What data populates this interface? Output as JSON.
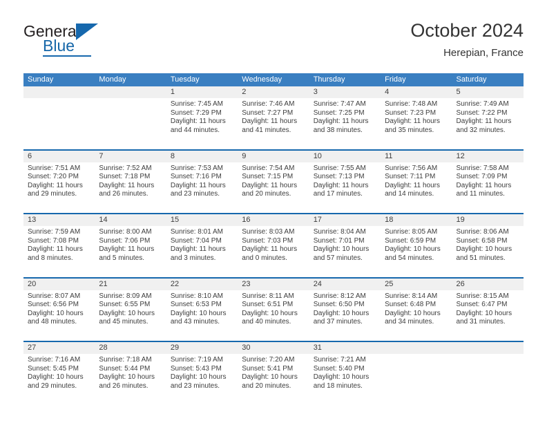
{
  "brand": {
    "name_part1": "General",
    "name_part2": "Blue",
    "accent_color": "#1668ad"
  },
  "header": {
    "title": "October 2024",
    "subtitle": "Herepian, France"
  },
  "calendar": {
    "header_bg": "#3a7fc1",
    "row_rule_color": "#1668ad",
    "day_band_bg": "#f0f0f0",
    "weekdays": [
      "Sunday",
      "Monday",
      "Tuesday",
      "Wednesday",
      "Thursday",
      "Friday",
      "Saturday"
    ],
    "weeks": [
      [
        {
          "day": "",
          "empty": true,
          "sunrise": "",
          "sunset": "",
          "daylight_line1": "",
          "daylight_line2": ""
        },
        {
          "day": "",
          "empty": true,
          "sunrise": "",
          "sunset": "",
          "daylight_line1": "",
          "daylight_line2": ""
        },
        {
          "day": "1",
          "empty": false,
          "sunrise": "Sunrise: 7:45 AM",
          "sunset": "Sunset: 7:29 PM",
          "daylight_line1": "Daylight: 11 hours",
          "daylight_line2": "and 44 minutes."
        },
        {
          "day": "2",
          "empty": false,
          "sunrise": "Sunrise: 7:46 AM",
          "sunset": "Sunset: 7:27 PM",
          "daylight_line1": "Daylight: 11 hours",
          "daylight_line2": "and 41 minutes."
        },
        {
          "day": "3",
          "empty": false,
          "sunrise": "Sunrise: 7:47 AM",
          "sunset": "Sunset: 7:25 PM",
          "daylight_line1": "Daylight: 11 hours",
          "daylight_line2": "and 38 minutes."
        },
        {
          "day": "4",
          "empty": false,
          "sunrise": "Sunrise: 7:48 AM",
          "sunset": "Sunset: 7:23 PM",
          "daylight_line1": "Daylight: 11 hours",
          "daylight_line2": "and 35 minutes."
        },
        {
          "day": "5",
          "empty": false,
          "sunrise": "Sunrise: 7:49 AM",
          "sunset": "Sunset: 7:22 PM",
          "daylight_line1": "Daylight: 11 hours",
          "daylight_line2": "and 32 minutes."
        }
      ],
      [
        {
          "day": "6",
          "empty": false,
          "sunrise": "Sunrise: 7:51 AM",
          "sunset": "Sunset: 7:20 PM",
          "daylight_line1": "Daylight: 11 hours",
          "daylight_line2": "and 29 minutes."
        },
        {
          "day": "7",
          "empty": false,
          "sunrise": "Sunrise: 7:52 AM",
          "sunset": "Sunset: 7:18 PM",
          "daylight_line1": "Daylight: 11 hours",
          "daylight_line2": "and 26 minutes."
        },
        {
          "day": "8",
          "empty": false,
          "sunrise": "Sunrise: 7:53 AM",
          "sunset": "Sunset: 7:16 PM",
          "daylight_line1": "Daylight: 11 hours",
          "daylight_line2": "and 23 minutes."
        },
        {
          "day": "9",
          "empty": false,
          "sunrise": "Sunrise: 7:54 AM",
          "sunset": "Sunset: 7:15 PM",
          "daylight_line1": "Daylight: 11 hours",
          "daylight_line2": "and 20 minutes."
        },
        {
          "day": "10",
          "empty": false,
          "sunrise": "Sunrise: 7:55 AM",
          "sunset": "Sunset: 7:13 PM",
          "daylight_line1": "Daylight: 11 hours",
          "daylight_line2": "and 17 minutes."
        },
        {
          "day": "11",
          "empty": false,
          "sunrise": "Sunrise: 7:56 AM",
          "sunset": "Sunset: 7:11 PM",
          "daylight_line1": "Daylight: 11 hours",
          "daylight_line2": "and 14 minutes."
        },
        {
          "day": "12",
          "empty": false,
          "sunrise": "Sunrise: 7:58 AM",
          "sunset": "Sunset: 7:09 PM",
          "daylight_line1": "Daylight: 11 hours",
          "daylight_line2": "and 11 minutes."
        }
      ],
      [
        {
          "day": "13",
          "empty": false,
          "sunrise": "Sunrise: 7:59 AM",
          "sunset": "Sunset: 7:08 PM",
          "daylight_line1": "Daylight: 11 hours",
          "daylight_line2": "and 8 minutes."
        },
        {
          "day": "14",
          "empty": false,
          "sunrise": "Sunrise: 8:00 AM",
          "sunset": "Sunset: 7:06 PM",
          "daylight_line1": "Daylight: 11 hours",
          "daylight_line2": "and 5 minutes."
        },
        {
          "day": "15",
          "empty": false,
          "sunrise": "Sunrise: 8:01 AM",
          "sunset": "Sunset: 7:04 PM",
          "daylight_line1": "Daylight: 11 hours",
          "daylight_line2": "and 3 minutes."
        },
        {
          "day": "16",
          "empty": false,
          "sunrise": "Sunrise: 8:03 AM",
          "sunset": "Sunset: 7:03 PM",
          "daylight_line1": "Daylight: 11 hours",
          "daylight_line2": "and 0 minutes."
        },
        {
          "day": "17",
          "empty": false,
          "sunrise": "Sunrise: 8:04 AM",
          "sunset": "Sunset: 7:01 PM",
          "daylight_line1": "Daylight: 10 hours",
          "daylight_line2": "and 57 minutes."
        },
        {
          "day": "18",
          "empty": false,
          "sunrise": "Sunrise: 8:05 AM",
          "sunset": "Sunset: 6:59 PM",
          "daylight_line1": "Daylight: 10 hours",
          "daylight_line2": "and 54 minutes."
        },
        {
          "day": "19",
          "empty": false,
          "sunrise": "Sunrise: 8:06 AM",
          "sunset": "Sunset: 6:58 PM",
          "daylight_line1": "Daylight: 10 hours",
          "daylight_line2": "and 51 minutes."
        }
      ],
      [
        {
          "day": "20",
          "empty": false,
          "sunrise": "Sunrise: 8:07 AM",
          "sunset": "Sunset: 6:56 PM",
          "daylight_line1": "Daylight: 10 hours",
          "daylight_line2": "and 48 minutes."
        },
        {
          "day": "21",
          "empty": false,
          "sunrise": "Sunrise: 8:09 AM",
          "sunset": "Sunset: 6:55 PM",
          "daylight_line1": "Daylight: 10 hours",
          "daylight_line2": "and 45 minutes."
        },
        {
          "day": "22",
          "empty": false,
          "sunrise": "Sunrise: 8:10 AM",
          "sunset": "Sunset: 6:53 PM",
          "daylight_line1": "Daylight: 10 hours",
          "daylight_line2": "and 43 minutes."
        },
        {
          "day": "23",
          "empty": false,
          "sunrise": "Sunrise: 8:11 AM",
          "sunset": "Sunset: 6:51 PM",
          "daylight_line1": "Daylight: 10 hours",
          "daylight_line2": "and 40 minutes."
        },
        {
          "day": "24",
          "empty": false,
          "sunrise": "Sunrise: 8:12 AM",
          "sunset": "Sunset: 6:50 PM",
          "daylight_line1": "Daylight: 10 hours",
          "daylight_line2": "and 37 minutes."
        },
        {
          "day": "25",
          "empty": false,
          "sunrise": "Sunrise: 8:14 AM",
          "sunset": "Sunset: 6:48 PM",
          "daylight_line1": "Daylight: 10 hours",
          "daylight_line2": "and 34 minutes."
        },
        {
          "day": "26",
          "empty": false,
          "sunrise": "Sunrise: 8:15 AM",
          "sunset": "Sunset: 6:47 PM",
          "daylight_line1": "Daylight: 10 hours",
          "daylight_line2": "and 31 minutes."
        }
      ],
      [
        {
          "day": "27",
          "empty": false,
          "sunrise": "Sunrise: 7:16 AM",
          "sunset": "Sunset: 5:45 PM",
          "daylight_line1": "Daylight: 10 hours",
          "daylight_line2": "and 29 minutes."
        },
        {
          "day": "28",
          "empty": false,
          "sunrise": "Sunrise: 7:18 AM",
          "sunset": "Sunset: 5:44 PM",
          "daylight_line1": "Daylight: 10 hours",
          "daylight_line2": "and 26 minutes."
        },
        {
          "day": "29",
          "empty": false,
          "sunrise": "Sunrise: 7:19 AM",
          "sunset": "Sunset: 5:43 PM",
          "daylight_line1": "Daylight: 10 hours",
          "daylight_line2": "and 23 minutes."
        },
        {
          "day": "30",
          "empty": false,
          "sunrise": "Sunrise: 7:20 AM",
          "sunset": "Sunset: 5:41 PM",
          "daylight_line1": "Daylight: 10 hours",
          "daylight_line2": "and 20 minutes."
        },
        {
          "day": "31",
          "empty": false,
          "sunrise": "Sunrise: 7:21 AM",
          "sunset": "Sunset: 5:40 PM",
          "daylight_line1": "Daylight: 10 hours",
          "daylight_line2": "and 18 minutes."
        },
        {
          "day": "",
          "empty": true,
          "sunrise": "",
          "sunset": "",
          "daylight_line1": "",
          "daylight_line2": ""
        },
        {
          "day": "",
          "empty": true,
          "sunrise": "",
          "sunset": "",
          "daylight_line1": "",
          "daylight_line2": ""
        }
      ]
    ]
  }
}
